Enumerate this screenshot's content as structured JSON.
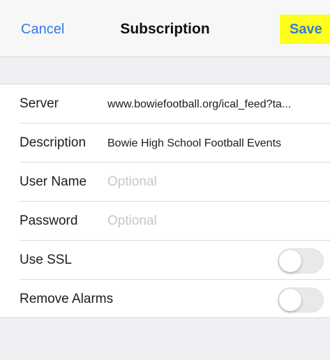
{
  "navbar": {
    "cancel_label": "Cancel",
    "title": "Subscription",
    "save_label": "Save",
    "accent_color": "#2f7de1",
    "save_highlight_color": "#ffff1a"
  },
  "form": {
    "server": {
      "label": "Server",
      "value": "www.bowiefootball.org/ical_feed?ta..."
    },
    "description": {
      "label": "Description",
      "value": "Bowie High School Football Events"
    },
    "user_name": {
      "label": "User Name",
      "value": "",
      "placeholder": "Optional"
    },
    "password": {
      "label": "Password",
      "value": "",
      "placeholder": "Optional"
    },
    "use_ssl": {
      "label": "Use SSL",
      "enabled": false
    },
    "remove_alarms": {
      "label": "Remove Alarms",
      "enabled": false
    }
  }
}
